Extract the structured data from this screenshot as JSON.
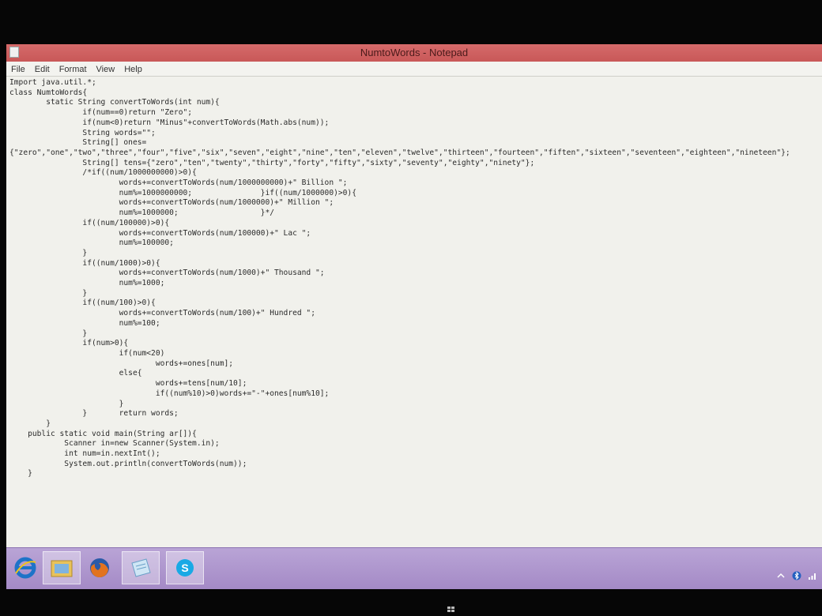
{
  "window": {
    "title": "NumtoWords - Notepad"
  },
  "menu": {
    "items": [
      "File",
      "Edit",
      "Format",
      "View",
      "Help"
    ]
  },
  "editor": {
    "lines": [
      "Import java.util.*;",
      "class NumtoWords{",
      "        static String convertToWords(int num){",
      "                if(num==0)return \"Zero\";",
      "                if(num<0)return \"Minus\"+convertToWords(Math.abs(num));",
      "                String words=\"\";",
      "                String[] ones=",
      "{\"zero\",\"one\",\"two\",\"three\",\"four\",\"five\",\"six\",\"seven\",\"eight\",\"nine\",\"ten\",\"eleven\",\"twelve\",\"thirteen\",\"fourteen\",\"fiften\",\"sixteen\",\"seventeen\",\"eighteen\",\"nineteen\"};",
      "                String[] tens={\"zero\",\"ten\",\"twenty\",\"thirty\",\"forty\",\"fifty\",\"sixty\",\"seventy\",\"eighty\",\"ninety\"};",
      "                /*if((num/1000000000)>0){",
      "                        words+=convertToWords(num/1000000000)+\" Billion \";",
      "                        num%=1000000000;               }if((num/1000000)>0){",
      "                        words+=convertToWords(num/1000000)+\" Million \";",
      "                        num%=1000000;                  }*/",
      "                if((num/100000)>0){",
      "                        words+=convertToWords(num/100000)+\" Lac \";",
      "                        num%=100000;",
      "                }",
      "                if((num/1000)>0){",
      "                        words+=convertToWords(num/1000)+\" Thousand \";",
      "                        num%=1000;",
      "                }",
      "                if((num/100)>0){",
      "                        words+=convertToWords(num/100)+\" Hundred \";",
      "                        num%=100;",
      "                }",
      "                if(num>0){",
      "                        if(num<20)",
      "                                words+=ones[num];",
      "                        else{",
      "                                words+=tens[num/10];",
      "                                if((num%10)>0)words+=\"-\"+ones[num%10];",
      "                        }",
      "                }       return words;",
      "        }",
      "    public static void main(String ar[]){",
      "            Scanner in=new Scanner(System.in);",
      "            int num=in.nextInt();",
      "            System.out.println(convertToWords(num));",
      "    }"
    ]
  },
  "taskbar": {
    "buttons": [
      {
        "name": "internet-explorer",
        "label": "e",
        "color": "#1e73c8"
      },
      {
        "name": "file-explorer",
        "color": "#e8c25a"
      },
      {
        "name": "firefox",
        "color": "#e2731f"
      },
      {
        "name": "notepad",
        "color": "#7bb8e0"
      },
      {
        "name": "skype",
        "color": "#19a9e5",
        "label": "S"
      }
    ]
  },
  "colors": {
    "titlebar": "#c85858",
    "editor_bg": "#f1f1ec",
    "taskbar": "#a48ac6"
  }
}
